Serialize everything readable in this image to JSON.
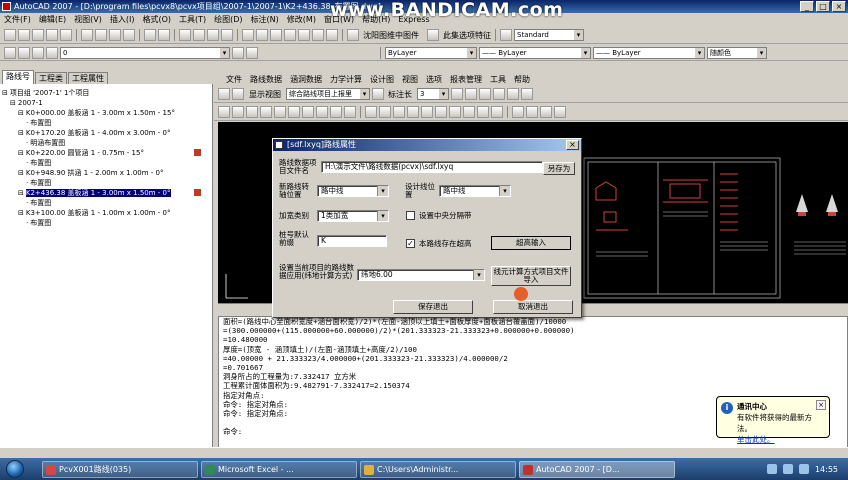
{
  "overlay": {
    "watermark": "www.BANDICAM.com"
  },
  "window": {
    "title": "AutoCAD 2007 - [D:\\program files\\pcvx8\\pcvx项目组\\2007-1\\2007-1\\K2+436.38_布置图.dwg]"
  },
  "menubar": {
    "items": [
      "文件(F)",
      "编辑(E)",
      "视图(V)",
      "插入(I)",
      "格式(O)",
      "工具(T)",
      "绘图(D)",
      "标注(N)",
      "修改(M)",
      "窗口(W)",
      "帮助(H)",
      "Express"
    ]
  },
  "toolbar_top": {
    "right_label": "沈阳图维中图件",
    "right_label2": "此集选项特征",
    "style_combo": "Standard"
  },
  "toolbar_props": {
    "layer": "0",
    "color": "ByLayer",
    "linetype": "—— ByLayer",
    "lineweight": "—— ByLayer",
    "plotstyle": "随颜色"
  },
  "left_panel": {
    "tabs": [
      "路线号",
      "工程类",
      "工程属性"
    ],
    "active_tab": 0,
    "tree": [
      {
        "text": "项目组 '2007-1' 1个项目",
        "indent": 0,
        "prefix": "⊟",
        "selected": false,
        "flag": false
      },
      {
        "text": "2007-1",
        "indent": 1,
        "prefix": "⊟",
        "selected": false,
        "flag": false
      },
      {
        "text": "K0+000.00 盖板涵 1 - 3.00m x 1.50m - 15°",
        "indent": 2,
        "prefix": "⊟",
        "selected": false,
        "flag": false
      },
      {
        "text": "布置图",
        "indent": 3,
        "prefix": "·",
        "selected": false,
        "flag": false
      },
      {
        "text": "K0+170.20 盖板涵 1 - 4.00m x 3.00m - 0°",
        "indent": 2,
        "prefix": "⊟",
        "selected": false,
        "flag": false
      },
      {
        "text": "明涵布置图",
        "indent": 3,
        "prefix": "·",
        "selected": false,
        "flag": false
      },
      {
        "text": "K0+220.00 圆管涵 1 - 0.75m - 15°",
        "indent": 2,
        "prefix": "⊟",
        "selected": false,
        "flag": true
      },
      {
        "text": "布置图",
        "indent": 3,
        "prefix": "·",
        "selected": false,
        "flag": false
      },
      {
        "text": "K0+948.90 拱涵 1 - 2.00m x 1.00m - 0°",
        "indent": 2,
        "prefix": "⊟",
        "selected": false,
        "flag": false
      },
      {
        "text": "布置图",
        "indent": 3,
        "prefix": "·",
        "selected": false,
        "flag": false
      },
      {
        "text": "K2+436.38 盖板涵 1 - 3.00m x 1.50m - 0°",
        "indent": 2,
        "prefix": "⊟",
        "selected": true,
        "flag": true
      },
      {
        "text": "布置图",
        "indent": 3,
        "prefix": "·",
        "selected": false,
        "flag": false
      },
      {
        "text": "K3+100.00 盖板涵 1 - 1.00m x 1.00m - 0°",
        "indent": 2,
        "prefix": "⊟",
        "selected": false,
        "flag": false
      },
      {
        "text": "布置图",
        "indent": 3,
        "prefix": "·",
        "selected": false,
        "flag": false
      }
    ]
  },
  "cad_menu": {
    "items": [
      "文件",
      "路线数据",
      "涵洞数据",
      "力学计算",
      "设计图",
      "视图",
      "选项",
      "报表管理",
      "工具",
      "帮助"
    ]
  },
  "cad_toolbar": {
    "view_label": "显示视图",
    "view_combo": "综合路线项目上报里",
    "scale_label": "标注长",
    "scale_value": "3"
  },
  "dialog": {
    "title": "[sdf.lxyq]路线属性",
    "file_label": "路线数据项目文件名",
    "file_value": "H:\\演示文件\\路线数据(pcvx)\\sdf.lxyq",
    "save_as": "另存为",
    "new_pos_label": "新路线转轴位置",
    "new_pos_value": "路中线",
    "design_pos_label": "设计线位置",
    "design_pos_value": "路中线",
    "widen_label": "加宽类别",
    "widen_value": "1类加宽",
    "center_divider_label": "设置中央分隔带",
    "center_divider_checked": false,
    "mileage_label": "桩号默认前缀",
    "mileage_value": "K",
    "slope_label": "本路线存在超高",
    "slope_checked": true,
    "superelevation_button": "超高输入",
    "calc_method_label": "设置当前项目的路线数据应用(纬地计算方式)",
    "calc_method_value": "纬地6.00",
    "import_button": "线元计算方式项目文件导入",
    "save_exit": "保存退出",
    "cancel_exit": "取消退出"
  },
  "command_lines": [
    "面积=(路线中心至面积宽度+涵台面积宽)/2)*(左面-涵顶以上填土+面板厚度+面板涵台覆盖面)/10000",
    "=(300.000000+(115.000000+60.000000)/2)*(201.333323-21.333323+0.000000+0.000000)",
    "=10.480000",
    "厚度=(顶宽 - 涵顶填土)/(左面-涵顶填土+高度/2)/100",
    "=40.00000 + 21.333323/4.000000+(201.333323-21.333323)/4.000000/2",
    "=0.701667",
    "洞身所占的工程量为:7.332417 立方米",
    "工程累计面体面积为:9.482791-7.332417=2.150374",
    "指定对角点:",
    "命令: 指定对角点:",
    "命令: 指定对角点:",
    "",
    "命令:"
  ],
  "balloon": {
    "title": "通讯中心",
    "text": "有软件将获得的最新方法。",
    "link": "单击此处。"
  },
  "taskbar": {
    "items": [
      {
        "label": "PcvX001路线(035)",
        "color": "#d04848",
        "active": false
      },
      {
        "label": "Microsoft Excel - ...",
        "color": "#2e8b57",
        "active": false
      },
      {
        "label": "C:\\Users\\Administr...",
        "color": "#e0b040",
        "active": false
      },
      {
        "label": "AutoCAD 2007 - [D...",
        "color": "#c03030",
        "active": true
      }
    ],
    "clock": "14:55"
  }
}
